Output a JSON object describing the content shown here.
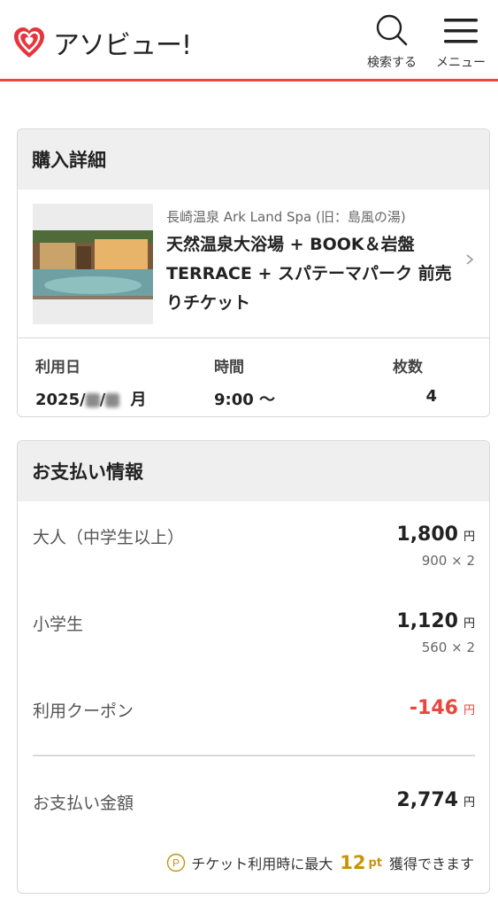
{
  "header": {
    "logo_text": "アソビュー!",
    "search_label": "検索する",
    "menu_label": "メニュー",
    "accent_color": "#f1453a"
  },
  "purchase": {
    "title": "購入詳細",
    "facility": "長崎温泉 Ark Land Spa (旧：島風の湯)",
    "product_name": "天然温泉大浴場 + BOOK＆岩盤TERRACE + スパテーマパーク 前売りチケット",
    "date_label": "利用日",
    "date_value_prefix": "2025/",
    "date_weekday": "月",
    "time_label": "時間",
    "time_value": "9:00 〜",
    "count_label": "枚数",
    "count_value": "4"
  },
  "payment": {
    "title": "お支払い情報",
    "rows": [
      {
        "label": "大人（中学生以上）",
        "amount": "1,800",
        "unit": "円",
        "detail": "900 × 2"
      },
      {
        "label": "小学生",
        "amount": "1,120",
        "unit": "円",
        "detail": "560 × 2"
      },
      {
        "label": "利用クーポン",
        "amount": "-146",
        "unit": "円"
      }
    ],
    "total_label": "お支払い金額",
    "total_amount": "2,774",
    "total_unit": "円",
    "points_text_before": "チケット利用時に最大",
    "points_value": "12",
    "points_unit": "pt",
    "points_text_after": "獲得できます",
    "points_icon": "point-coin-icon"
  }
}
